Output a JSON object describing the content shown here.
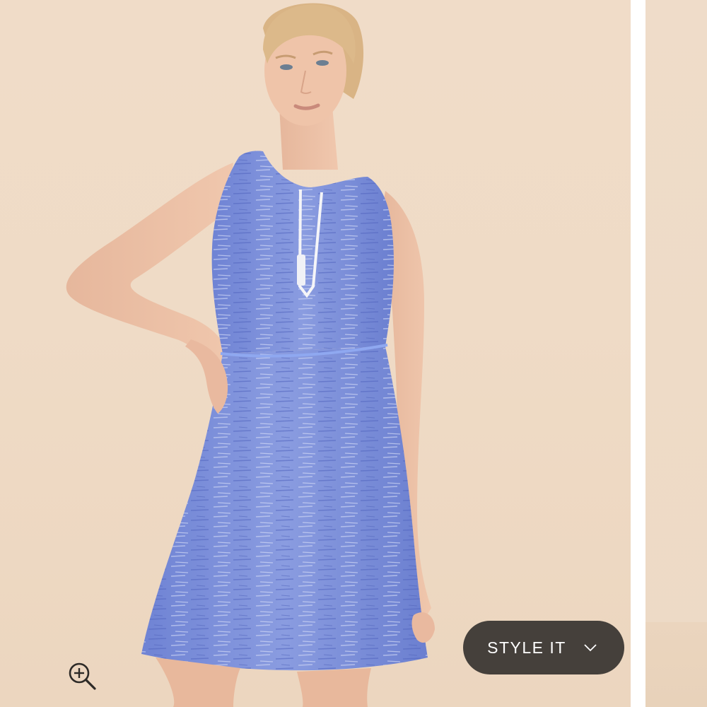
{
  "product_gallery": {
    "main_image": {
      "alt": "",
      "icon": "product-photo"
    },
    "zoom": {
      "icon": "zoom-in-icon"
    },
    "style_it": {
      "label": "STYLE IT",
      "icon": "chevron-down-icon"
    },
    "next_image": {
      "icon": "product-photo"
    }
  },
  "colors": {
    "backdrop": "#efdbc6",
    "button_background": "#45403b",
    "button_text": "#ffffff",
    "dress": "#7f91d9"
  }
}
